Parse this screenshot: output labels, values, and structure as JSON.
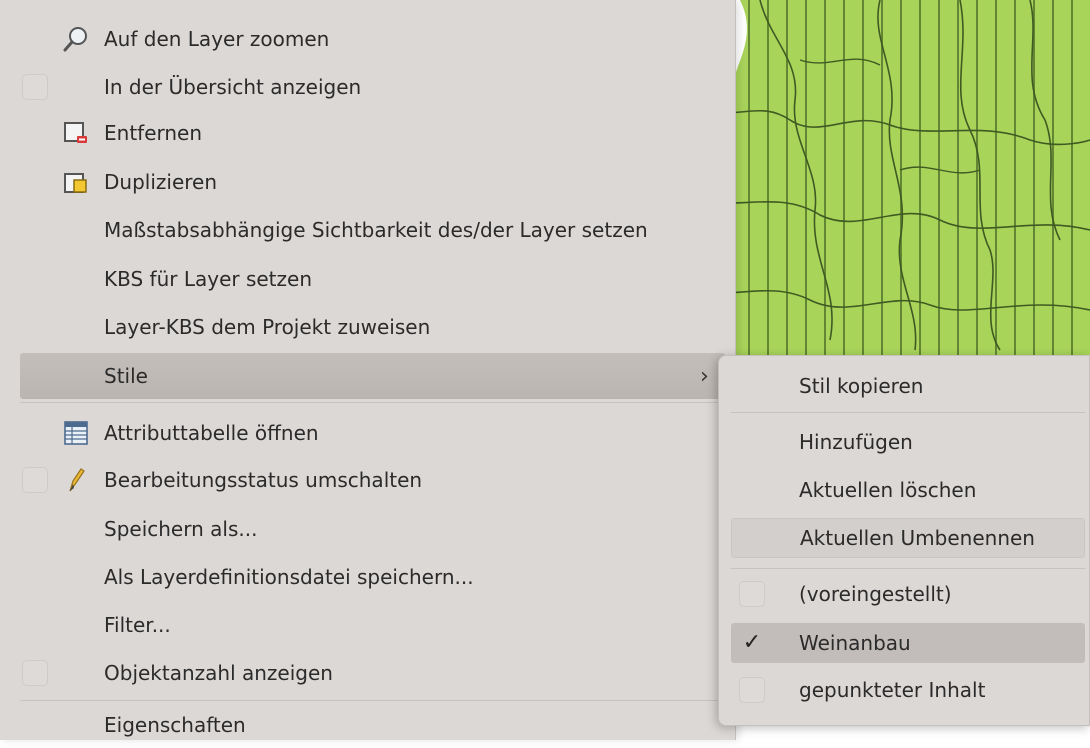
{
  "menu": {
    "items": [
      {
        "label": "Auf den Layer zoomen",
        "icon": "zoom-layer-icon"
      },
      {
        "label": "In der Übersicht anzeigen",
        "checkbox": true
      },
      {
        "label": "Entfernen",
        "icon": "remove-layer-icon"
      },
      {
        "label": "Duplizieren",
        "icon": "duplicate-layer-icon"
      },
      {
        "label": "Maßstabsabhängige Sichtbarkeit des/der Layer setzen"
      },
      {
        "label": "KBS für Layer setzen"
      },
      {
        "label": "Layer-KBS dem Projekt zuweisen"
      },
      {
        "label": "Stile",
        "submenu_arrow": "›"
      },
      {
        "label": "Attributtabelle öffnen",
        "icon": "attribute-table-icon"
      },
      {
        "label": "Bearbeitungsstatus umschalten",
        "icon": "pencil-icon",
        "checkbox": true
      },
      {
        "label": "Speichern als..."
      },
      {
        "label": "Als Layerdefinitionsdatei speichern..."
      },
      {
        "label": "Filter..."
      },
      {
        "label": "Objektanzahl anzeigen",
        "checkbox": true
      },
      {
        "label": "Eigenschaften"
      }
    ]
  },
  "submenu": {
    "items": [
      {
        "label": "Stil kopieren"
      },
      {
        "label": "Hinzufügen"
      },
      {
        "label": "Aktuellen löschen"
      },
      {
        "label": "Aktuellen Umbenennen"
      },
      {
        "label": "(voreingestellt)",
        "checked": false
      },
      {
        "label": "Weinanbau",
        "checked": true,
        "checkmark": "✓"
      },
      {
        "label": "gepunkteter Inhalt",
        "checked": false
      }
    ]
  },
  "colors": {
    "menu_bg": "#dcd8d6",
    "highlight": "#c3beba",
    "map_fill": "#a8d45a"
  }
}
